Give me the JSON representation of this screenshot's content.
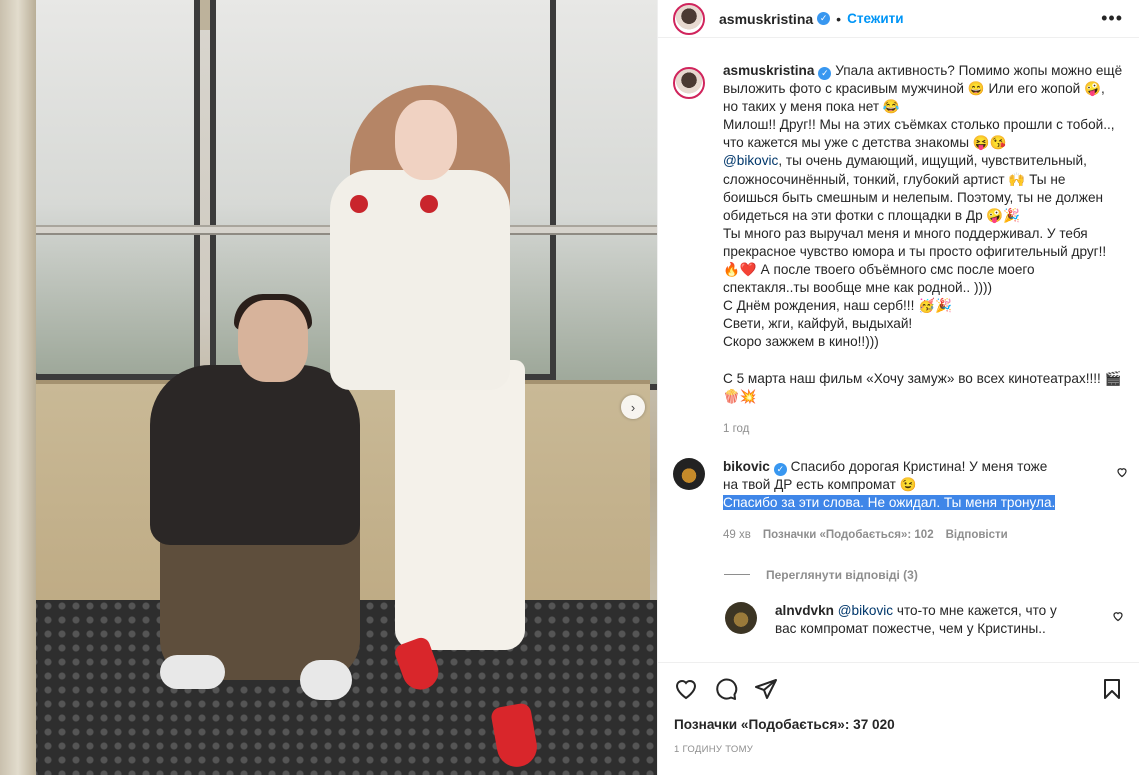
{
  "post": {
    "author": "asmuskristina",
    "verified_badge": "✓",
    "dot": "•",
    "follow_label": "Стежити",
    "more_label": "•••",
    "next_label": "›"
  },
  "caption": {
    "author": "asmuskristina",
    "lines": [
      "Упала активность? Помимо жопы можно ещё",
      "выложить фото с красивым мужчиной 😄 Или его жопой 🤪,",
      "но таких у меня пока нет 😂",
      "Милош!! Друг!! Мы на этих съёмках столько прошли с тобой..,",
      "что кажется мы уже с детства знакомы 😝😘",
      "@bikovic, ты очень думающий, ищущий, чувствительный,",
      "сложносочинённый, тонкий, глубокий артист 🙌 Ты не",
      "боишься быть смешным и нелепым. Поэтому, ты не должен",
      "обидеться на эти фотки с площадки в Др 🤪🎉",
      "Ты много раз выручал меня и много поддерживал. У тебя",
      "прекрасное чувство юмора и ты просто офигительный друг!!",
      "🔥❤️ А после твоего объёмного смс после моего",
      "спектакля..ты вообще мне как родной.. ))))",
      "С Днём рождения, наш серб!!! 🥳🎉",
      "Свети, жги, кайфуй, выдыхай!",
      "Скоро зажжем в кино!!)))",
      "",
      "С 5 марта наш фильм «Хочу замуж» во всех кинотеатрах!!!! 🎬",
      "🍿💥"
    ],
    "mention": "@bikovic",
    "time": "1 год"
  },
  "comments": [
    {
      "author": "bikovic",
      "text": "Спасибо дорогая Кристина! У меня тоже на твой ДР есть компромат 😉",
      "highlight": "Спасибо за эти слова. Не ожидал. Ты меня тронула.",
      "time": "49 хв",
      "likes": "Позначки «Подобається»: 102",
      "reply_label": "Відповісти"
    }
  ],
  "view_replies": "Переглянути відповіді (3)",
  "reply": {
    "author": "alnvdvkn",
    "mention": "@bikovic",
    "text": "что-то мне кажется, что у вас компромат пожестче, чем у Кристины.."
  },
  "footer": {
    "likes": "Позначки «Подобається»: 37 020",
    "posted": "1 ГОДИНУ ТОМУ"
  },
  "icons": [
    "heart-icon",
    "comment-icon",
    "share-icon",
    "bookmark-icon"
  ]
}
